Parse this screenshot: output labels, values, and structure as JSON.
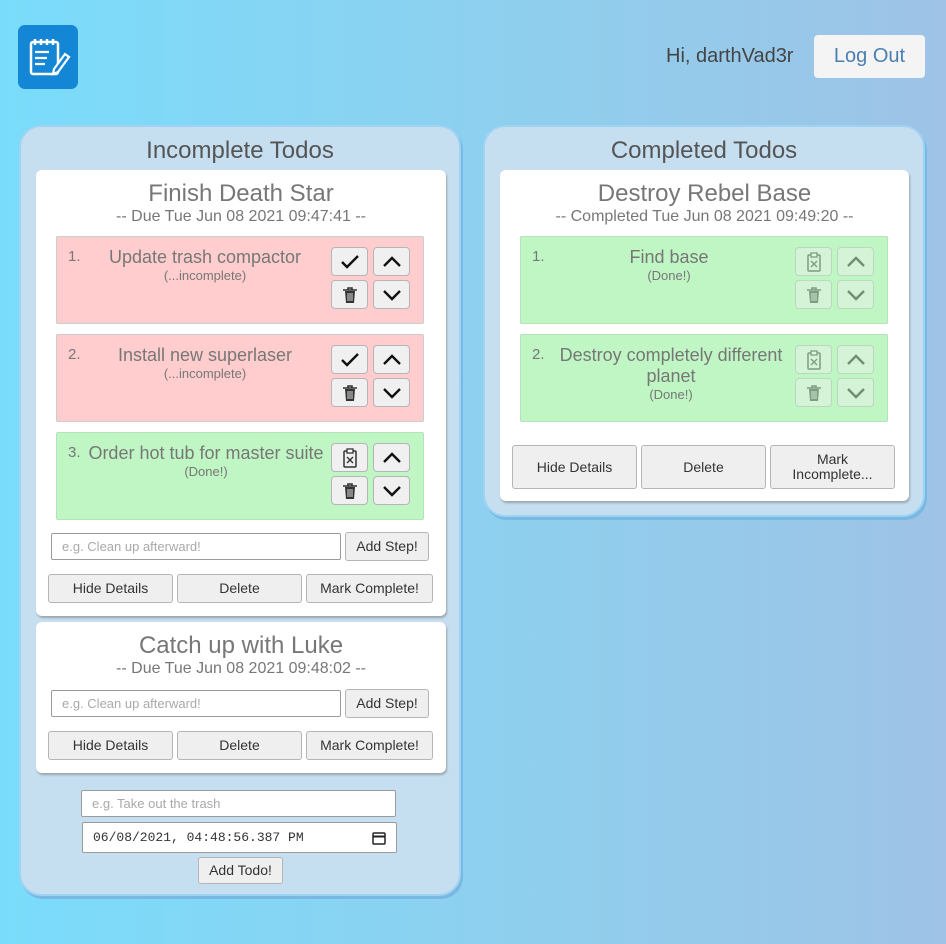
{
  "header": {
    "greeting": "Hi, darthVad3r",
    "logout_label": "Log Out"
  },
  "incomplete": {
    "title": "Incomplete Todos",
    "todos": [
      {
        "title": "Finish Death Star",
        "date": "-- Due Tue Jun 08 2021 09:47:41 --",
        "steps": [
          {
            "num": "1.",
            "text": "Update trash compactor",
            "status": "(...incomplete)"
          },
          {
            "num": "2.",
            "text": "Install new superlaser",
            "status": "(...incomplete)"
          },
          {
            "num": "3.",
            "text": "Order hot tub for master suite",
            "status": "(Done!)"
          }
        ],
        "step_placeholder": "e.g. Clean up afterward!",
        "add_step_label": "Add Step!",
        "hide_label": "Hide Details",
        "delete_label": "Delete",
        "mark_label": "Mark Complete!"
      },
      {
        "title": "Catch up with Luke",
        "date": "-- Due Tue Jun 08 2021 09:48:02 --",
        "step_placeholder": "e.g. Clean up afterward!",
        "add_step_label": "Add Step!",
        "hide_label": "Hide Details",
        "delete_label": "Delete",
        "mark_label": "Mark Complete!"
      }
    ],
    "new_todo": {
      "placeholder": "e.g. Take out the trash",
      "date_value": "06/08/2021, 04:48:56.387 PM",
      "add_label": "Add Todo!"
    }
  },
  "completed": {
    "title": "Completed Todos",
    "todos": [
      {
        "title": "Destroy Rebel Base",
        "date": "-- Completed Tue Jun 08 2021 09:49:20 --",
        "steps": [
          {
            "num": "1.",
            "text": "Find base",
            "status": "(Done!)"
          },
          {
            "num": "2.",
            "text": "Destroy completely different planet",
            "status": "(Done!)"
          }
        ],
        "hide_label": "Hide Details",
        "delete_label": "Delete",
        "mark_label": "Mark Incomplete..."
      }
    ]
  },
  "colors": {
    "step_incomplete": "#ffcdcd",
    "step_done": "#bff6c4",
    "logo": "#1486d6"
  }
}
